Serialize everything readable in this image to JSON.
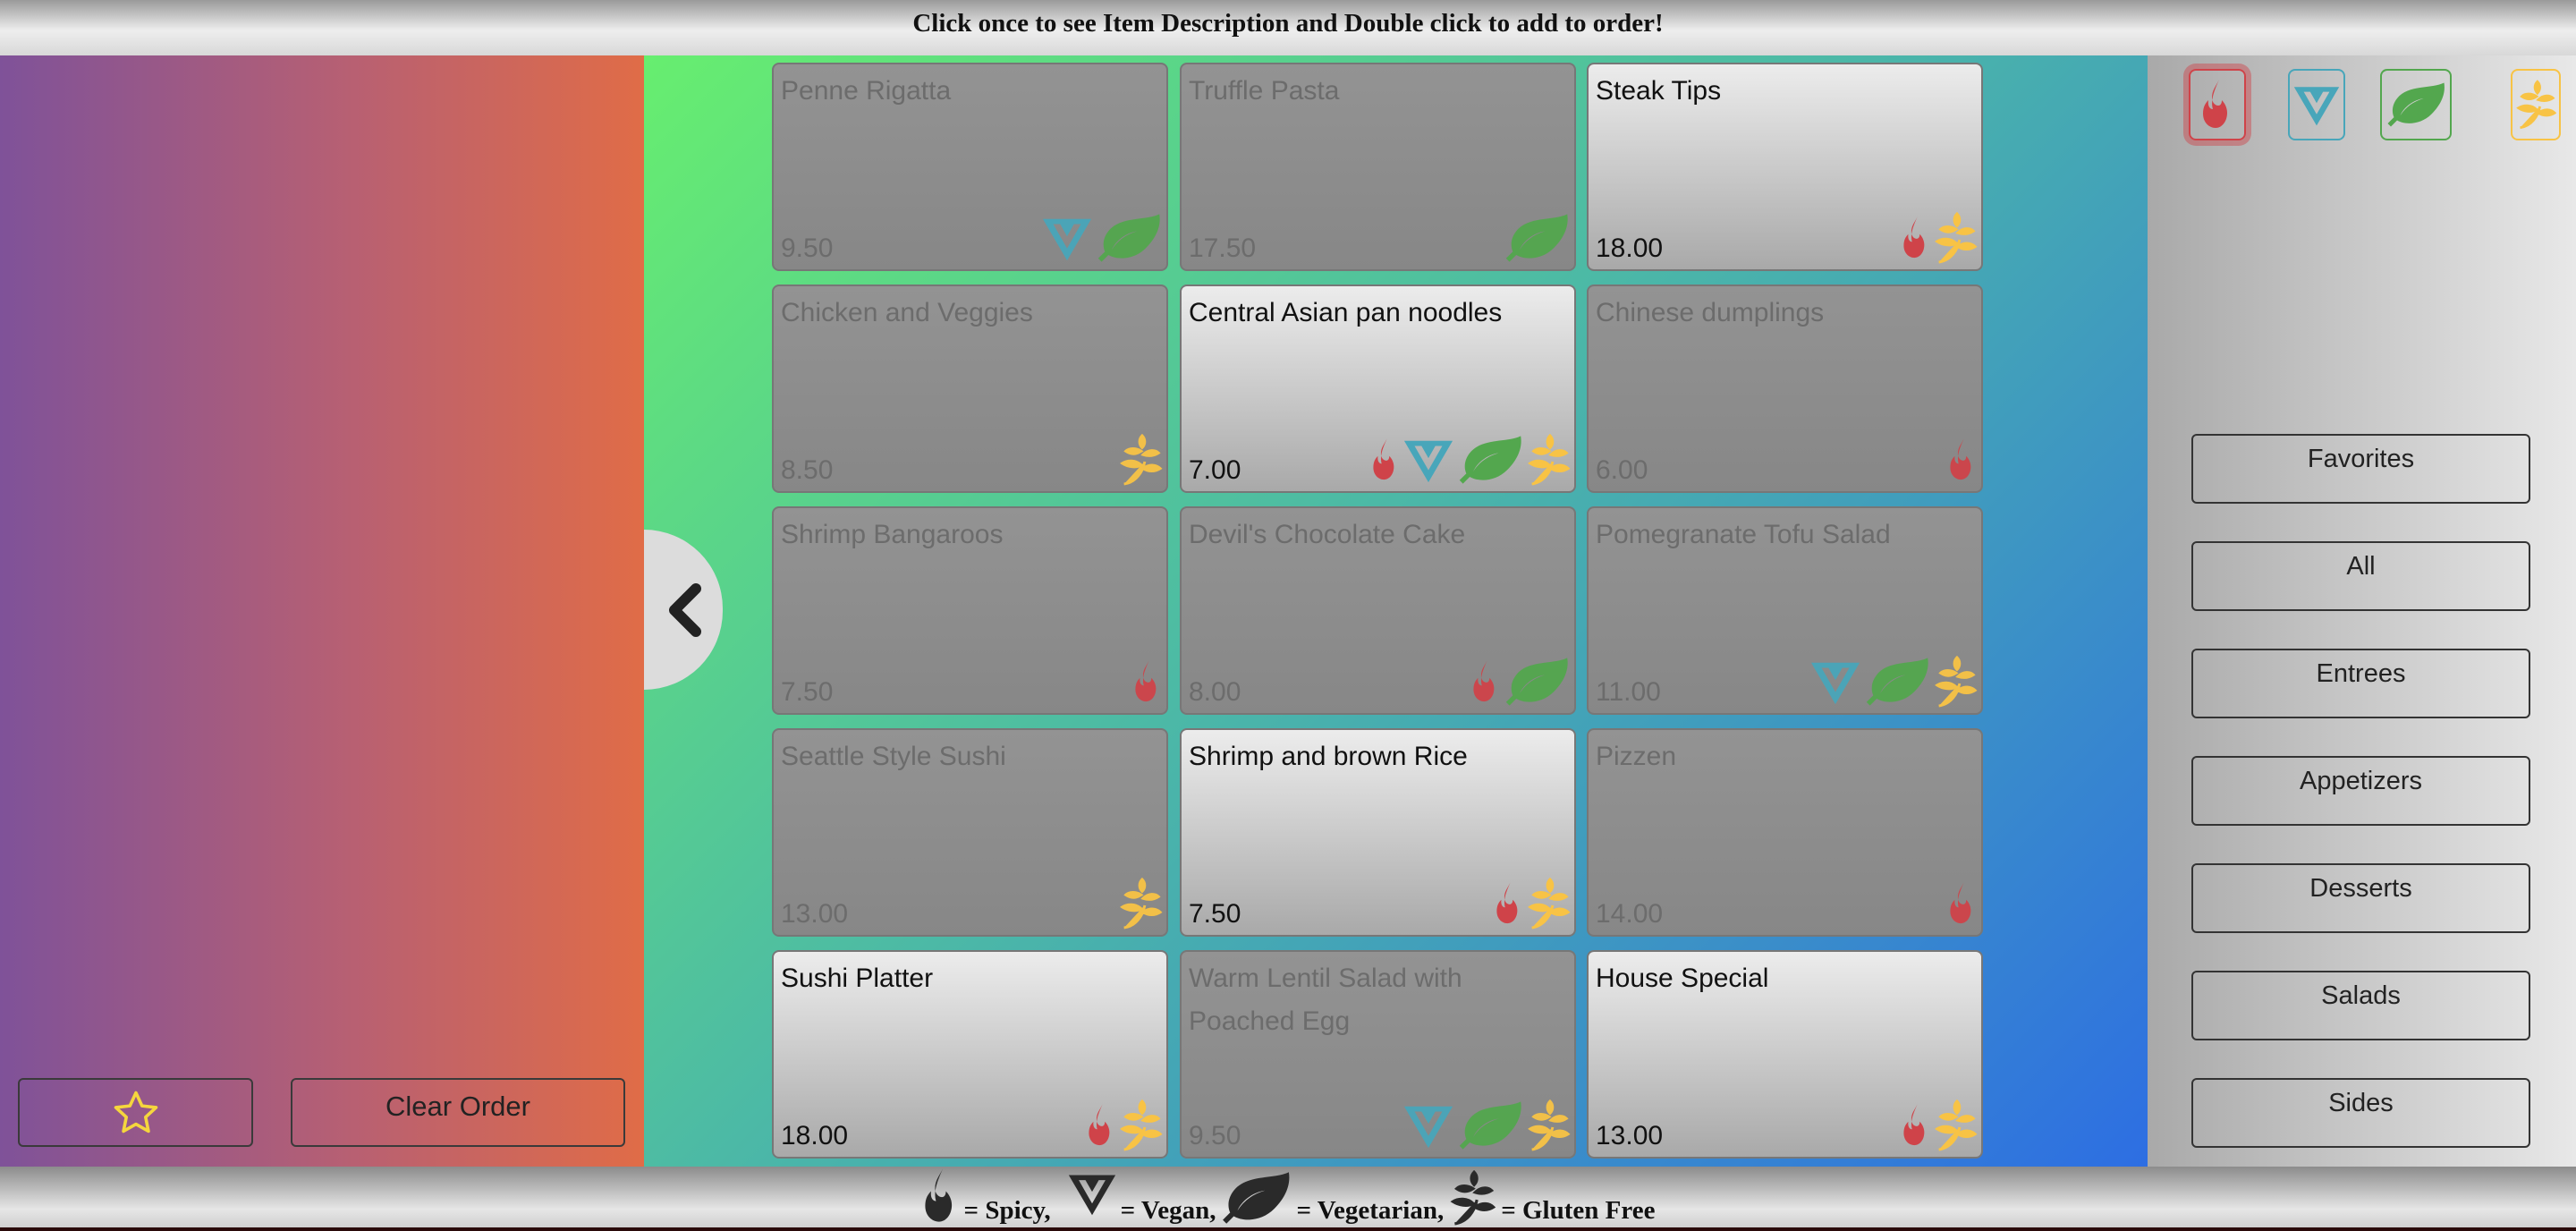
{
  "header": {
    "instruction": "Click once to see Item Description and Double click to add to order!"
  },
  "order_panel": {
    "favorite_icon": "star-icon",
    "clear_label": "Clear Order"
  },
  "menu": {
    "back_icon": "chevron-left-icon",
    "items": [
      {
        "name": "Penne Rigatta",
        "price": "9.50",
        "active": false,
        "tags": [
          "vegan",
          "vegetarian"
        ]
      },
      {
        "name": "Truffle Pasta",
        "price": "17.50",
        "active": false,
        "tags": [
          "vegetarian"
        ]
      },
      {
        "name": "Steak Tips",
        "price": "18.00",
        "active": true,
        "tags": [
          "spicy",
          "gluten-free"
        ]
      },
      {
        "name": "Chicken and Veggies",
        "price": "8.50",
        "active": false,
        "tags": [
          "gluten-free"
        ]
      },
      {
        "name": "Central Asian pan noodles",
        "price": "7.00",
        "active": true,
        "tags": [
          "spicy",
          "vegan",
          "vegetarian",
          "gluten-free"
        ]
      },
      {
        "name": "Chinese dumplings",
        "price": "6.00",
        "active": false,
        "tags": [
          "spicy"
        ]
      },
      {
        "name": "Shrimp Bangaroos",
        "price": "7.50",
        "active": false,
        "tags": [
          "spicy"
        ]
      },
      {
        "name": "Devil's Chocolate Cake",
        "price": "8.00",
        "active": false,
        "tags": [
          "spicy",
          "vegetarian"
        ]
      },
      {
        "name": "Pomegranate Tofu Salad",
        "price": "11.00",
        "active": false,
        "tags": [
          "vegan",
          "vegetarian",
          "gluten-free"
        ]
      },
      {
        "name": "Seattle Style Sushi",
        "price": "13.00",
        "active": false,
        "tags": [
          "gluten-free"
        ]
      },
      {
        "name": "Shrimp and brown Rice",
        "price": "7.50",
        "active": true,
        "tags": [
          "spicy",
          "gluten-free"
        ]
      },
      {
        "name": "Pizzen",
        "price": "14.00",
        "active": false,
        "tags": [
          "spicy"
        ]
      },
      {
        "name": "Sushi Platter",
        "price": "18.00",
        "active": true,
        "tags": [
          "spicy",
          "gluten-free"
        ]
      },
      {
        "name": "Warm Lentil Salad with Poached Egg",
        "price": "9.50",
        "active": false,
        "tags": [
          "vegan",
          "vegetarian",
          "gluten-free"
        ]
      },
      {
        "name": "House Special",
        "price": "13.00",
        "active": true,
        "tags": [
          "spicy",
          "gluten-free"
        ]
      }
    ]
  },
  "filters": [
    {
      "tag": "spicy",
      "icon": "flame-icon",
      "color": "#cf4349",
      "selected": true
    },
    {
      "tag": "vegan",
      "icon": "vegan-icon",
      "color": "#48a6ba",
      "selected": false
    },
    {
      "tag": "vegetarian",
      "icon": "leaf-icon",
      "color": "#53a74e",
      "selected": false
    },
    {
      "tag": "gluten-free",
      "icon": "wheat-icon",
      "color": "#f8c345",
      "selected": false
    }
  ],
  "categories": [
    "Favorites",
    "All",
    "Entrees",
    "Appetizers",
    "Desserts",
    "Salads",
    "Sides"
  ],
  "legend": {
    "spicy": "= Spicy,",
    "vegan": "= Vegan,",
    "vegetarian": "= Vegetarian,",
    "gluten_free": "= Gluten Free"
  },
  "colors": {
    "spicy": "#cf4349",
    "vegan": "#48a6ba",
    "vegetarian": "#53a74e",
    "gluten-free": "#f8c345",
    "legend": "#2a2a2a"
  }
}
